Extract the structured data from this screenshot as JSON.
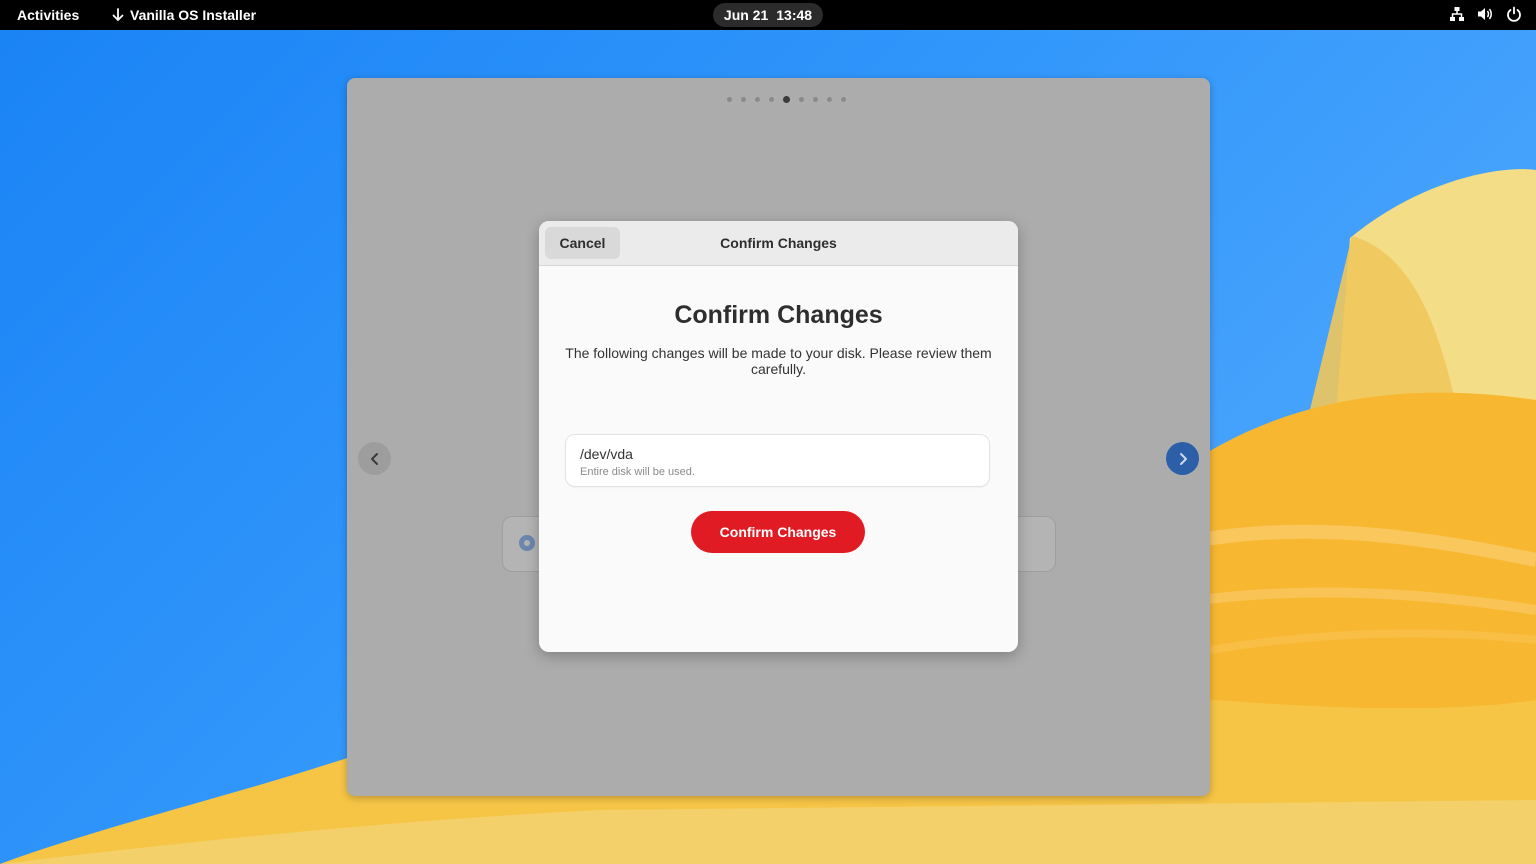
{
  "topbar": {
    "activities_label": "Activities",
    "app_name": "Vanilla OS Installer",
    "date": "Jun 21",
    "time": "13:48",
    "tray_icons": [
      "network-icon",
      "volume-icon",
      "power-icon"
    ]
  },
  "installer": {
    "page_count": 9,
    "active_page": 5,
    "prev_icon": "chevron-left-icon",
    "next_icon": "chevron-right-icon"
  },
  "dialog": {
    "header_title": "Confirm Changes",
    "cancel_label": "Cancel",
    "title": "Confirm Changes",
    "description": "The following changes will be made to your disk. Please review them carefully.",
    "disk": {
      "name": "/dev/vda",
      "detail": "Entire disk will be used."
    },
    "confirm_label": "Confirm Changes"
  },
  "colors": {
    "accent_blue": "#2c5fa8",
    "destructive_red": "#e01b24",
    "topbar": "#000000"
  }
}
